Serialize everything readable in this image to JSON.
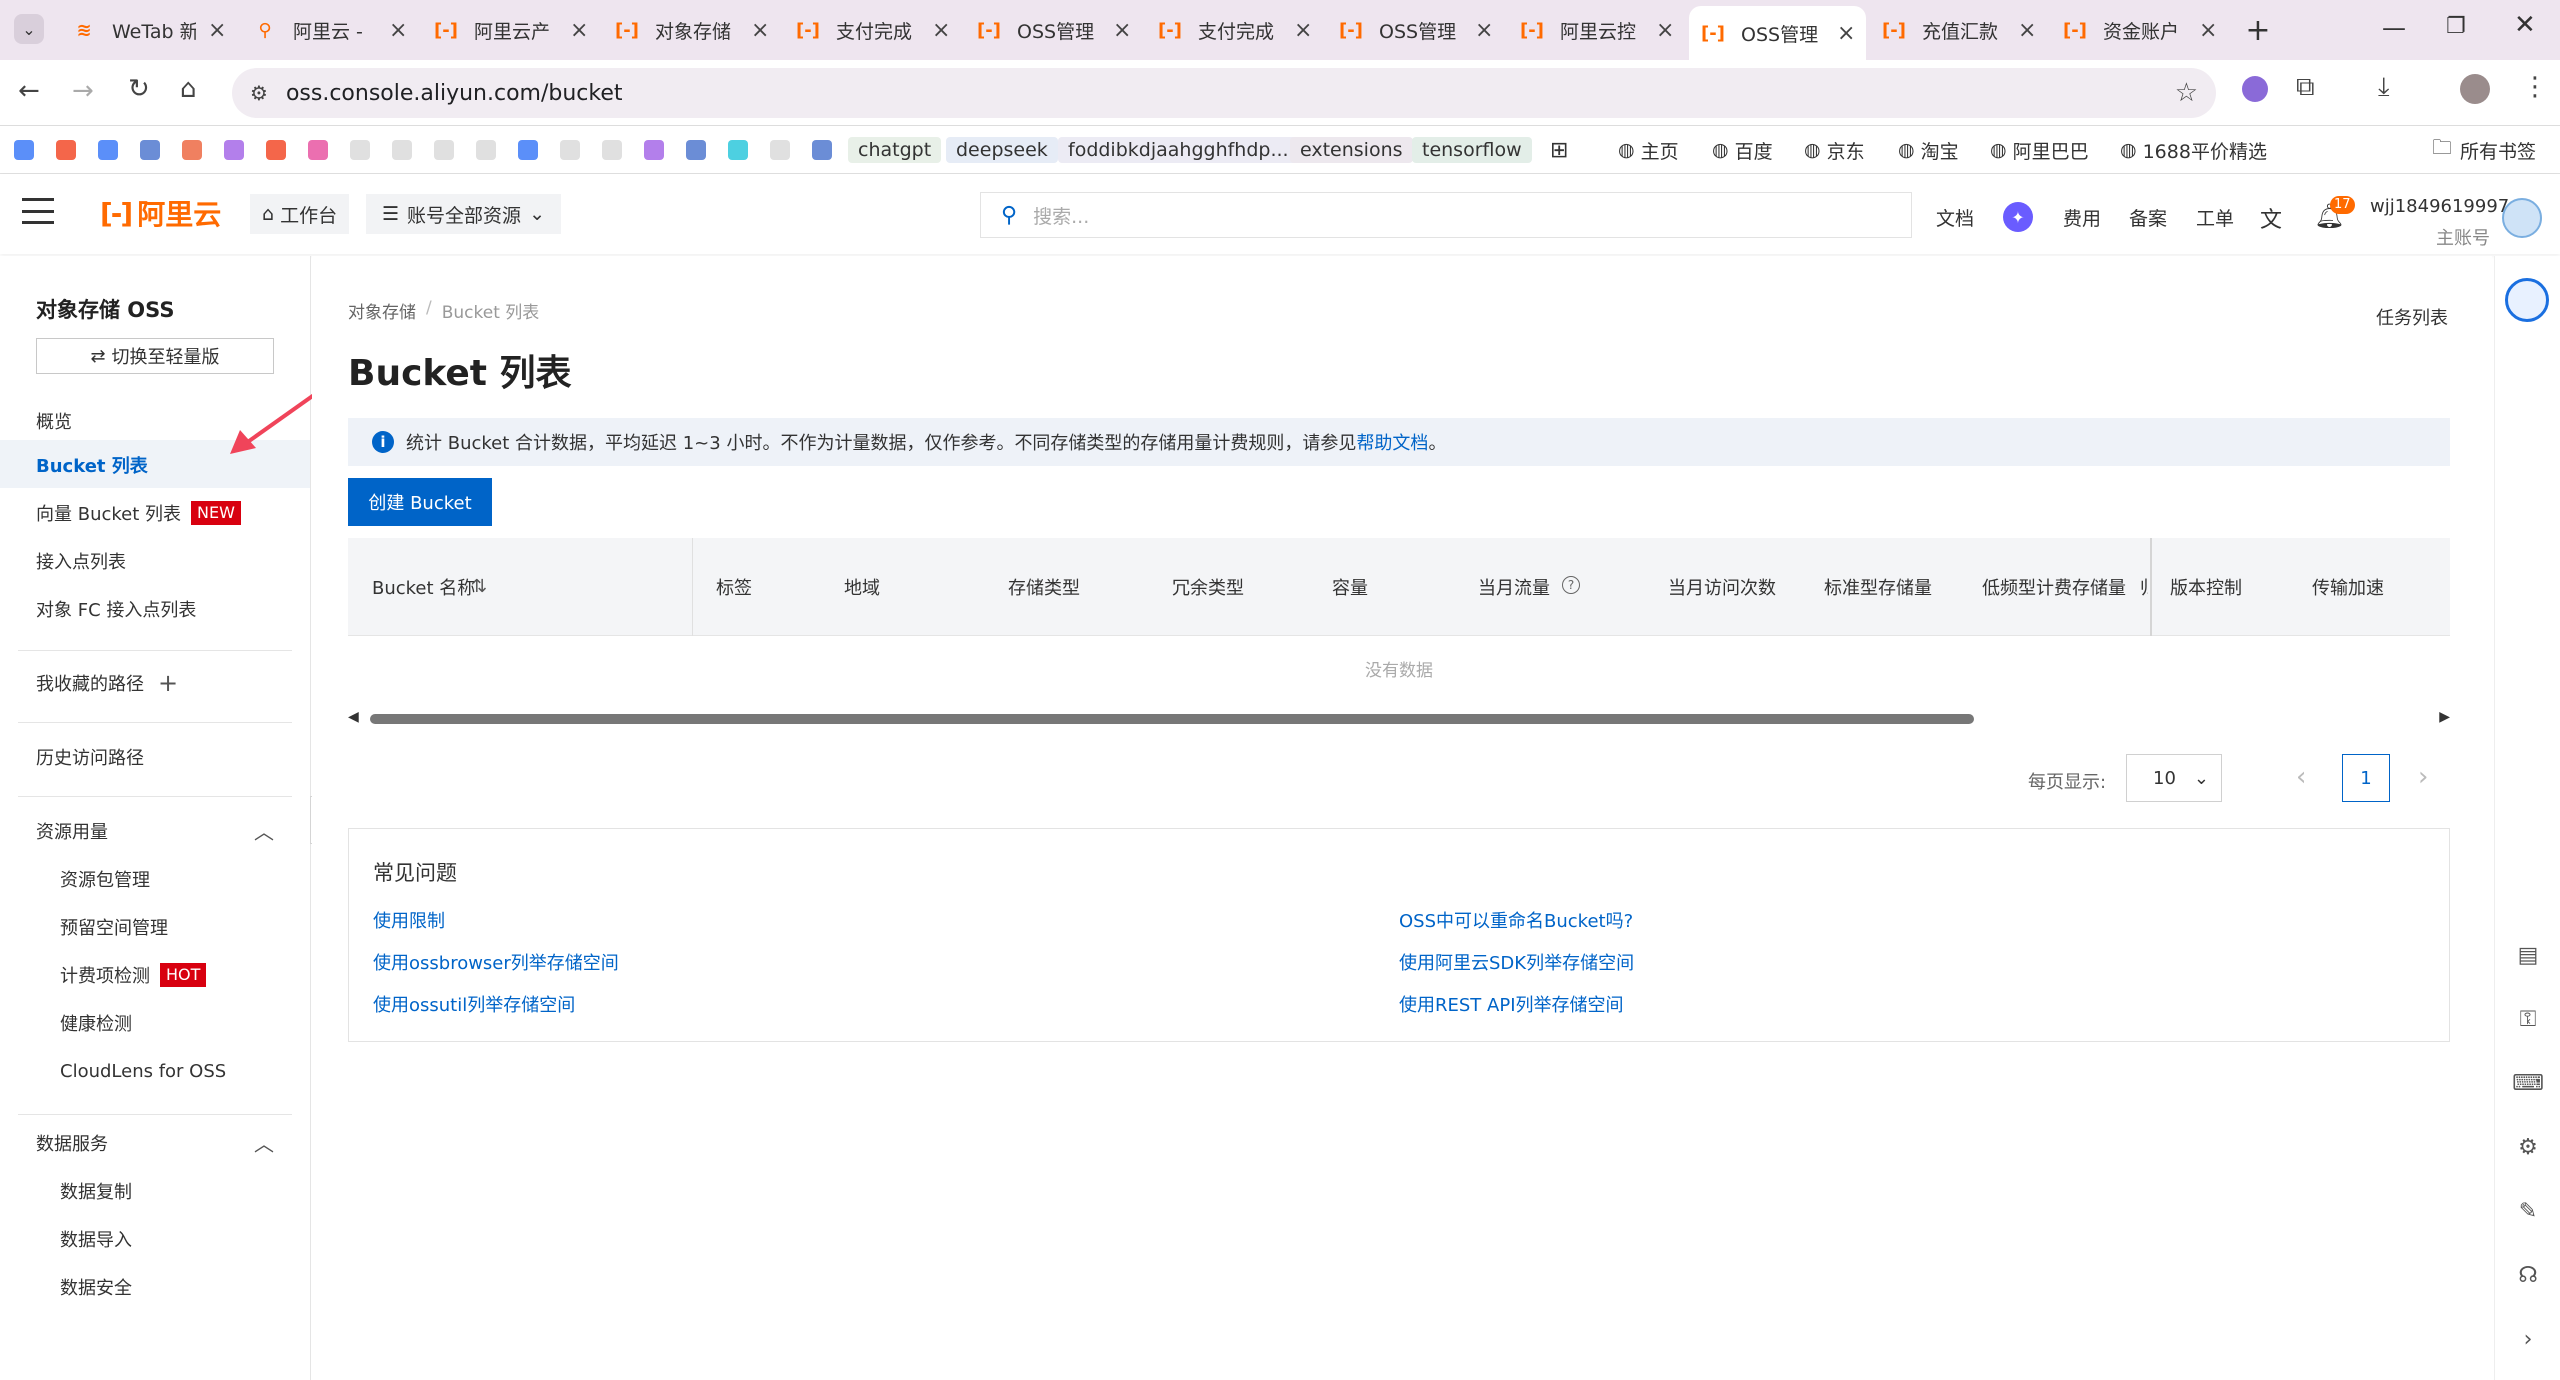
{
  "browser": {
    "tabs": [
      {
        "title": "WeTab 新",
        "icon": "wetab-icon",
        "active": false
      },
      {
        "title": "阿里云 -",
        "icon": "search-icon",
        "active": false
      },
      {
        "title": "阿里云产",
        "icon": "aliyun-icon",
        "active": false
      },
      {
        "title": "对象存储",
        "icon": "aliyun-icon",
        "active": false
      },
      {
        "title": "支付完成",
        "icon": "aliyun-icon",
        "active": false
      },
      {
        "title": "OSS管理",
        "icon": "aliyun-icon",
        "active": false
      },
      {
        "title": "支付完成",
        "icon": "aliyun-icon",
        "active": false
      },
      {
        "title": "OSS管理",
        "icon": "aliyun-icon",
        "active": false
      },
      {
        "title": "阿里云控",
        "icon": "aliyun-icon",
        "active": false
      },
      {
        "title": "OSS管理",
        "icon": "aliyun-icon",
        "active": true
      },
      {
        "title": "充值汇款",
        "icon": "aliyun-icon",
        "active": false
      },
      {
        "title": "资金账户",
        "icon": "aliyun-icon",
        "active": false
      }
    ],
    "url": "oss.console.aliyun.com/bucket",
    "bookmarks_named": [
      {
        "label": "chatgpt",
        "bg": "#e8f0e8"
      },
      {
        "label": "deepseek",
        "bg": "#e6ecf6"
      },
      {
        "label": "foddibkdjaahgghfhdp...",
        "bg": "#ecebf4"
      },
      {
        "label": "extensions",
        "bg": "#ede8ee"
      },
      {
        "label": "tensorflow",
        "bg": "#e3eee8"
      }
    ],
    "bookmarks_sites": [
      "主页",
      "百度",
      "京东",
      "淘宝",
      "阿里巴巴",
      "1688平价精选"
    ],
    "all_bookmarks": "所有书签"
  },
  "header": {
    "logo_text": "阿里云",
    "workbench": "工作台",
    "resource_scope": "账号全部资源",
    "search_placeholder": "搜索...",
    "links": [
      "文档",
      "费用",
      "备案",
      "工单"
    ],
    "notification_count": "17",
    "username": "wjj1849619997",
    "account_type": "主账号"
  },
  "sidebar": {
    "product_title": "对象存储 OSS",
    "switch_button": "切换至轻量版",
    "items": [
      {
        "label": "概览"
      },
      {
        "label": "Bucket 列表",
        "selected": true
      },
      {
        "label": "向量 Bucket 列表",
        "badge": "NEW"
      },
      {
        "label": "接入点列表"
      },
      {
        "label": "对象 FC 接入点列表"
      }
    ],
    "favorites": "我收藏的路径",
    "history": "历史访问路径",
    "resource_group": {
      "title": "资源用量",
      "items": [
        {
          "label": "资源包管理"
        },
        {
          "label": "预留空间管理"
        },
        {
          "label": "计费项检测",
          "badge": "HOT"
        },
        {
          "label": "健康检测"
        },
        {
          "label": "CloudLens for OSS"
        }
      ]
    },
    "data_group": {
      "title": "数据服务",
      "items": [
        {
          "label": "数据复制"
        },
        {
          "label": "数据导入"
        },
        {
          "label": "数据安全"
        }
      ]
    }
  },
  "main": {
    "breadcrumb": [
      "对象存储",
      "Bucket 列表"
    ],
    "task_list": "任务列表",
    "page_title": "Bucket 列表",
    "notice_text": "统计 Bucket 合计数据，平均延迟 1~3 小时。不作为计量数据，仅作参考。不同存储类型的存储用量计费规则，请参见",
    "notice_link": "帮助文档",
    "notice_end": "。",
    "create_button": "创建 Bucket",
    "table": {
      "columns": [
        "Bucket 名称",
        "标签",
        "地域",
        "存储类型",
        "冗余类型",
        "容量",
        "当月流量",
        "当月访问次数",
        "标准型存储量",
        "低频型计费存储量",
        "归",
        "版本控制",
        "传输加速"
      ],
      "empty_text": "没有数据"
    },
    "pagination": {
      "per_page_label": "每页显示:",
      "per_page": "10",
      "current_page": "1"
    },
    "faq": {
      "title": "常见问题",
      "left": [
        "使用限制",
        "使用ossbrowser列举存储空间",
        "使用ossutil列举存储空间"
      ],
      "right": [
        "OSS中可以重命名Bucket吗?",
        "使用阿里云SDK列举存储空间",
        "使用REST API列举存储空间"
      ]
    }
  },
  "colors": {
    "brand": "#ff6a00",
    "primary": "#0064c8",
    "badge_red": "#d8000f",
    "tab_bg": "#eee5ef"
  }
}
